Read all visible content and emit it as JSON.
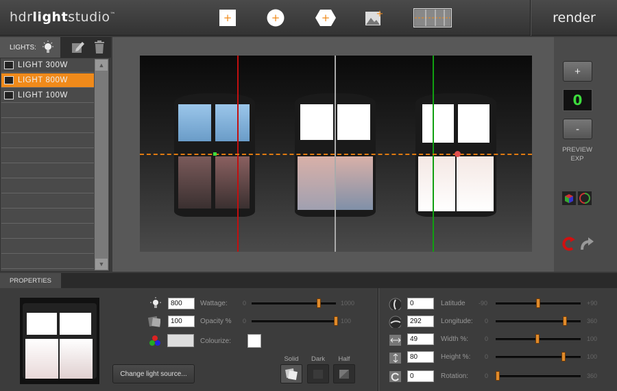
{
  "app": {
    "logo_light": "hdr",
    "logo_bold": "light",
    "logo_tail": "studio",
    "render_label": "render"
  },
  "toolbar": {
    "icons": [
      "add-rect-light-icon",
      "add-circle-light-icon",
      "add-hexagon-light-icon",
      "add-image-light-icon",
      "panorama-view-icon"
    ]
  },
  "lights_panel": {
    "tab_label": "LIGHTS:",
    "items": [
      {
        "label": "LIGHT  300W",
        "selected": false
      },
      {
        "label": "LIGHT  800W",
        "selected": true
      },
      {
        "label": "LIGHT  100W",
        "selected": false
      }
    ]
  },
  "preview": {
    "plus_label": "+",
    "minus_label": "-",
    "exposure_value": "0",
    "exposure_label_1": "PREVIEW",
    "exposure_label_2": "EXP"
  },
  "properties": {
    "tab_label": "PROPERTIES",
    "change_source_label": "Change light source...",
    "wattage": {
      "value": "800",
      "label": "Wattage:",
      "min": "0",
      "max": "1000",
      "fraction": 0.8
    },
    "opacity": {
      "value": "100",
      "label": "Opacity %",
      "min": "0",
      "max": "100",
      "fraction": 1.0
    },
    "colourize_label": "Colourize:",
    "modes": {
      "solid": "Solid",
      "dark": "Dark",
      "half": "Half"
    },
    "latitude": {
      "value": "0",
      "label": "Latitude",
      "min": "-90",
      "max": "+90",
      "fraction": 0.5
    },
    "longitude": {
      "value": "292",
      "label": "Longitude:",
      "min": "0",
      "max": "360",
      "fraction": 0.811
    },
    "width": {
      "value": "49",
      "label": "Width %:",
      "min": "0",
      "max": "100",
      "fraction": 0.49
    },
    "height": {
      "value": "80",
      "label": "Height %:",
      "min": "0",
      "max": "100",
      "fraction": 0.8
    },
    "rotation": {
      "value": "0",
      "label": "Rotation:",
      "min": "0",
      "max": "360",
      "fraction": 0.0
    }
  },
  "colors": {
    "accent": "#f08a1a",
    "exposure_green": "#3ddc3d",
    "line_red": "#c01010",
    "line_white": "#aaaaaa",
    "line_green": "#10a010"
  }
}
